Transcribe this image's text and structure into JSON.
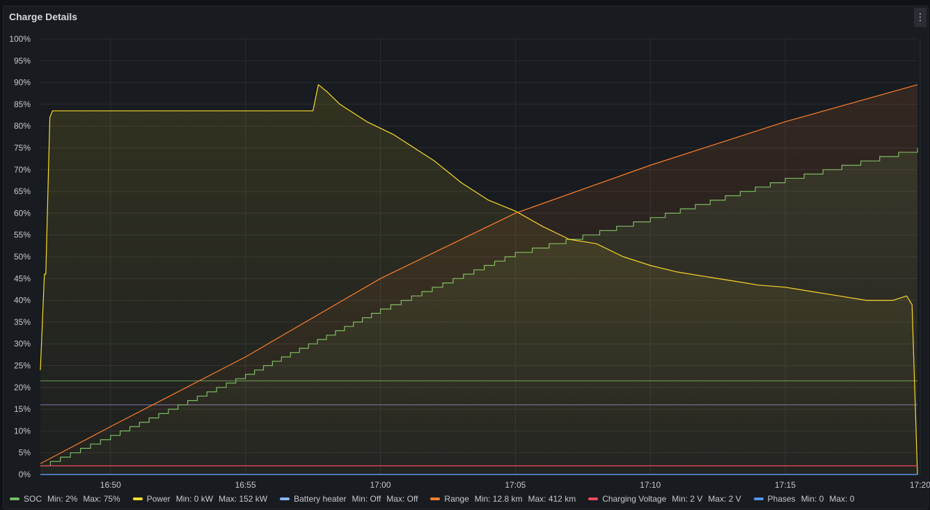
{
  "panel": {
    "title": "Charge Details",
    "menu_icon": "kebab-menu-icon",
    "menu_glyph": "⋮"
  },
  "chart_data": {
    "type": "line",
    "ylim": [
      0,
      100
    ],
    "y_ticks": [
      "0%",
      "5%",
      "10%",
      "15%",
      "20%",
      "25%",
      "30%",
      "35%",
      "40%",
      "45%",
      "50%",
      "55%",
      "60%",
      "65%",
      "70%",
      "75%",
      "80%",
      "85%",
      "90%",
      "95%",
      "100%"
    ],
    "x_ticks": [
      "16:50",
      "16:55",
      "17:00",
      "17:05",
      "17:10",
      "17:15",
      "17:20"
    ],
    "x_tick_minutes": [
      0,
      5,
      10,
      15,
      20,
      25,
      30
    ],
    "xlim_minutes": [
      -2.6,
      29.9
    ],
    "grid": true,
    "legend_position": "bottom",
    "series": [
      {
        "name": "SOC",
        "color": "#73bf69",
        "min": "2%",
        "max": "75%",
        "x": [
          -2.6,
          0,
          5,
          10,
          15,
          20,
          25,
          29.9
        ],
        "y": [
          2,
          9,
          23,
          38,
          51,
          59,
          68,
          75
        ]
      },
      {
        "name": "Power",
        "color": "#fade2a",
        "min": "0 kW",
        "max": "152 kW",
        "x": [
          -2.6,
          -2.45,
          -2.4,
          -2.25,
          -2.15,
          -2.0,
          -1.9,
          7.5,
          7.7,
          8.0,
          8.5,
          9,
          9.5,
          10,
          10.5,
          11,
          12,
          13,
          14,
          15,
          16,
          17,
          18,
          19,
          20,
          21,
          22,
          23,
          24,
          25,
          26,
          27,
          28,
          29,
          29.5,
          29.7,
          29.9
        ],
        "y": [
          24,
          46,
          46,
          82,
          83.5,
          83.5,
          83.5,
          83.5,
          89.5,
          88,
          85,
          83,
          81,
          79.5,
          78,
          76,
          72,
          67,
          63,
          60.5,
          57,
          54,
          53,
          50,
          48,
          46.5,
          45.5,
          44.5,
          43.5,
          43,
          42,
          41,
          40,
          40,
          41,
          39,
          0
        ]
      },
      {
        "name": "Battery heater",
        "color": "#8ab8ff",
        "min": "Off",
        "max": "Off",
        "x": [
          -2.6,
          29.9
        ],
        "y": [
          0,
          0
        ]
      },
      {
        "name": "Range",
        "color": "#ff7f2e",
        "min": "12.8 km",
        "max": "412 km",
        "x": [
          -2.6,
          0,
          5,
          10,
          15,
          20,
          25,
          29.9
        ],
        "y": [
          2.5,
          11,
          27,
          45,
          60,
          71,
          81,
          89.5
        ]
      },
      {
        "name": "Charging Voltage",
        "color": "#f2495c",
        "min": "2 V",
        "max": "2 V",
        "x": [
          -2.6,
          29.9
        ],
        "y": [
          2,
          2
        ]
      },
      {
        "name": "Phases",
        "color": "#5794f2",
        "min": "0",
        "max": "0",
        "x": [
          -2.6,
          29.9
        ],
        "y": [
          0,
          0
        ]
      }
    ],
    "threshold_lines": [
      {
        "y": 21.5,
        "color": "#73bf69"
      },
      {
        "y": 16,
        "color": "#a48bdb"
      }
    ]
  },
  "legend": {
    "min_label": "Min:",
    "max_label": "Max:"
  }
}
